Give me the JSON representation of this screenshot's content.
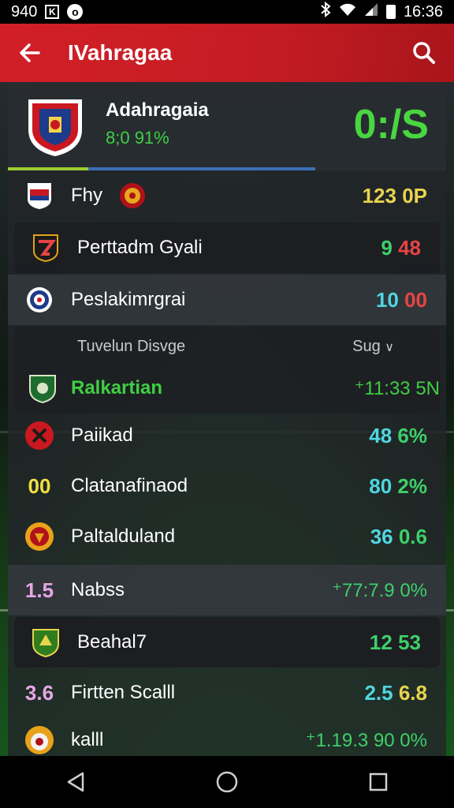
{
  "status_bar": {
    "left_text": "940",
    "time": "16:36",
    "icons": [
      "notification-box-icon",
      "notification-circle-icon",
      "bluetooth-icon",
      "wifi-icon",
      "signal-icon",
      "battery-icon"
    ]
  },
  "app_bar": {
    "title": "IVahragaa",
    "back_icon": "arrow-left-icon",
    "search_icon": "search-icon",
    "color": "#d21f27"
  },
  "team_header": {
    "name": "Adahragaia",
    "subtitle": "8;0 91%",
    "score": "0:/S"
  },
  "rows": [
    {
      "label": "Fhy",
      "value": "123 0P",
      "value_color": "#e8d44d"
    },
    {
      "label": "Perttadm Gyali",
      "value_a": "9",
      "value_b": "48",
      "color_a": "#3ecf6a",
      "color_b": "#e84444"
    },
    {
      "label": "Peslakimrgrai",
      "value_a": "10",
      "value_b": "00",
      "color_a": "#4fd6e0",
      "color_b": "#e84444"
    }
  ],
  "section": {
    "head_left": "Tuvelun Disvge",
    "head_right": "Sug",
    "row_label": "Ralkartian",
    "row_value": "⁺11:33 5N"
  },
  "rows2": [
    {
      "badge": "",
      "label": "Paiikad",
      "value_a": "48",
      "value_b": "6%"
    },
    {
      "badge": "00",
      "label": "Clatanafinaod",
      "value_a": "80",
      "value_b": "2%"
    },
    {
      "badge": "",
      "label": "Paltalduland",
      "value_a": "36",
      "value_b": "0.6"
    },
    {
      "badge": "1.5",
      "label": "Nabss",
      "value": "⁺77:7.9 0%"
    },
    {
      "badge": "",
      "label": "Beahal7",
      "value_a": "12",
      "value_b": "53"
    },
    {
      "badge": "3.6",
      "label": "Firtten Scalll",
      "value_a": "2.5",
      "value_b": "6.8"
    },
    {
      "badge": "",
      "label": "kalll",
      "value": "⁺1.19.3 90 0%"
    }
  ],
  "nav": [
    "back-triangle-icon",
    "home-circle-icon",
    "recents-square-icon"
  ]
}
